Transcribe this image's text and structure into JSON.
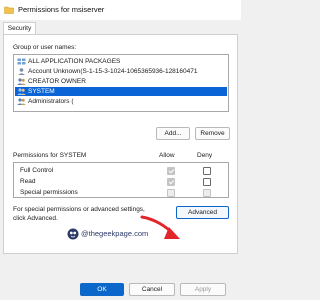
{
  "window": {
    "title": "Permissions for msiserver",
    "app_icon": "folder-icon"
  },
  "tabs": [
    {
      "label": "Security",
      "active": true
    }
  ],
  "groups": {
    "label": "Group or user names:",
    "items": [
      {
        "label": "ALL APPLICATION PACKAGES",
        "icon": "package-group-icon",
        "selected": false
      },
      {
        "label": "Account Unknown(S-1-15-3-1024-1065365936-128160471",
        "icon": "user-unknown-icon",
        "selected": false
      },
      {
        "label": "CREATOR OWNER",
        "icon": "users-icon",
        "selected": false
      },
      {
        "label": "SYSTEM",
        "icon": "users-icon",
        "selected": true
      },
      {
        "label": "Administrators (",
        "icon": "users-icon",
        "selected": false
      }
    ],
    "add_button": "Add...",
    "remove_button": "Remove"
  },
  "permissions": {
    "label": "Permissions for SYSTEM",
    "allow_header": "Allow",
    "deny_header": "Deny",
    "rows": [
      {
        "name": "Full Control",
        "allow": "checked-disabled",
        "deny": "unchecked"
      },
      {
        "name": "Read",
        "allow": "checked-disabled",
        "deny": "unchecked"
      },
      {
        "name": "Special permissions",
        "allow": "disabled",
        "deny": "disabled"
      }
    ]
  },
  "advanced": {
    "text_line1": "For special permissions or advanced settings,",
    "text_line2": "click Advanced.",
    "button": "Advanced"
  },
  "footer": {
    "ok": "OK",
    "cancel": "Cancel",
    "apply": "Apply"
  },
  "watermark": {
    "text": "@thegeekpage.com"
  },
  "colors": {
    "selection": "#0a64d6",
    "primary_button": "#0b67c9",
    "annotation_arrow": "#e2262b"
  }
}
